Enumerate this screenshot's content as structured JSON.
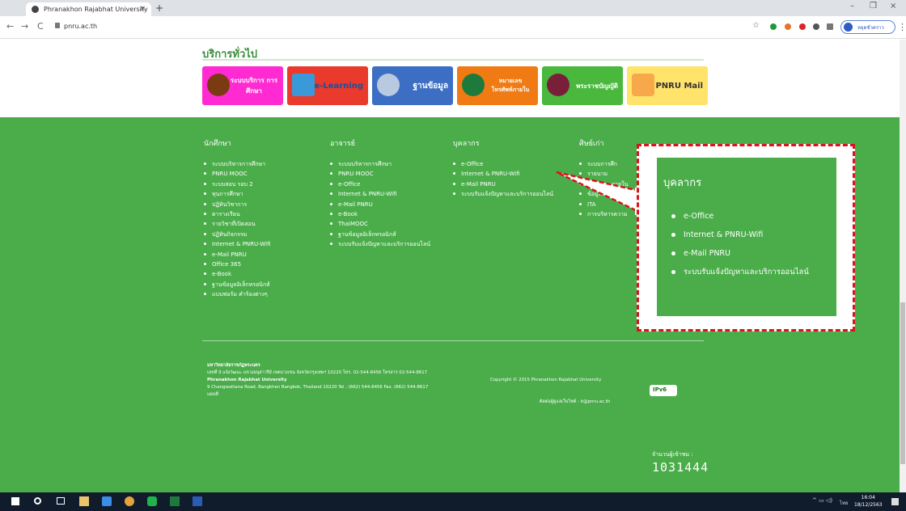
{
  "browser": {
    "tab_title": "Phranakhon Rajabhat University",
    "tab_close": "×",
    "new_tab": "+",
    "win_min": "–",
    "win_max": "❐",
    "win_close": "×",
    "back": "←",
    "forward": "→",
    "reload": "C",
    "url": "pnru.ac.th",
    "profile_label": "หยุดชั่วคราว",
    "profile_initial": "B",
    "menu": "⋮",
    "star": "☆"
  },
  "services": {
    "title": "บริการทั่วไป",
    "banners": [
      {
        "label": "ระบบบริการ การศึกษา",
        "color": "#ff2ad2"
      },
      {
        "label": "e-Learning",
        "color": "#e93a2c"
      },
      {
        "label": "ฐานข้อมูล",
        "color": "#3c6fc4"
      },
      {
        "label": "หมายเลข โทรศัพท์ภายใน",
        "color": "#f07b14"
      },
      {
        "label": "พระราชบัญญัติ",
        "color": "#49b83c"
      },
      {
        "label": "PNRU Mail",
        "color": "#ffe36a"
      }
    ]
  },
  "footer": {
    "columns": [
      {
        "heading": "นักศึกษา",
        "items": [
          "ระบบบริหารการศึกษา",
          "PNRU MOOC",
          "ระบบสอบ รอบ 2",
          "ทุนการศึกษา",
          "ปฏิทินวิชาการ",
          "ตารางเรียน",
          "รายวิชาที่เปิดสอน",
          "ปฏิทินกิจกรรม",
          "Internet & PNRU-Wifi",
          "e-Mail PNRU",
          "Office 365",
          "e-Book",
          "ฐานข้อมูลอิเล็กทรอนิกส์",
          "แบบฟอร์ม คำร้องต่างๆ"
        ]
      },
      {
        "heading": "อาจารย์",
        "items": [
          "ระบบบริหารการศึกษา",
          "PNRU MOOC",
          "e-Office",
          "Internet & PNRU-Wifi",
          "e-Mail PNRU",
          "e-Book",
          "ThaiMOOC",
          "ฐานข้อมูลอิเล็กทรอนิกส์",
          "ระบบรับแจ้งปัญหาและบริการออนไลน์"
        ]
      },
      {
        "heading": "บุคลากร",
        "items": [
          "e-Office",
          "Internet & PNRU-Wifi",
          "e-Mail PNRU",
          "ระบบรับแจ้งปัญหาและบริการออนไลน์"
        ]
      },
      {
        "heading": "ศิษย์เก่า",
        "items": [
          "ระบบการศึก",
          "",
          "",
          "รายนาม",
          "หน่วยงานภายใน",
          "ข้อมูลพื้นฐาน",
          "ITA",
          "การบริหารความ"
        ]
      }
    ],
    "address_th_name": "มหาวิทยาลัยราชภัฏพระนคร",
    "address_th": "เลขที่ 9 แจ้งวัฒนะ แขวงอนุสาวรีย์ เขตบางเขน จังหวัดกรุงเทพฯ 10220 โทร. 02-544-8456 โทรสาร 02-544-8617",
    "address_en_name": "Phranakhon Rajabhat University",
    "address_en": "9 Changwattana Road, Bangkhen Bangkok, Thailand 10220 Tel : (662) 544-8456 Fax. (662) 544-8617",
    "map_link": "แผนที่",
    "copyright": "Copyright © 2015 Phranakhon Rajabhat University",
    "contact": "ติดต่อผู้ดูแลเว็บไซต์ : it@pnru.ac.th",
    "ipv6": "IPv6",
    "visits_label": "จำนวนผู้เข้าชม :",
    "visits_count": "1031444"
  },
  "callout": {
    "heading": "บุคลากร",
    "items": [
      "e-Office",
      "Internet & PNRU-Wifi",
      "e-Mail PNRU",
      "ระบบรับแจ้งปัญหาและบริการออนไลน์"
    ]
  },
  "taskbar": {
    "lang": "ไทย",
    "time": "16:04",
    "date": "18/12/2563"
  }
}
